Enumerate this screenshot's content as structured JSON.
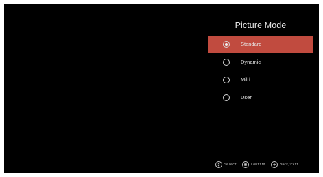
{
  "menu": {
    "title": "Picture Mode",
    "options": [
      {
        "label": "Standard",
        "selected": true
      },
      {
        "label": "Dynamic",
        "selected": false
      },
      {
        "label": "Mild",
        "selected": false
      },
      {
        "label": "User",
        "selected": false
      }
    ],
    "highlight_color": "#c14b3f"
  },
  "footer": {
    "hints": [
      {
        "icon": "dpad-updown-icon",
        "label": "Select"
      },
      {
        "icon": "ok-button-icon",
        "label": "Confirm"
      },
      {
        "icon": "back-arrow-icon",
        "label": "Back/Exit"
      }
    ]
  }
}
